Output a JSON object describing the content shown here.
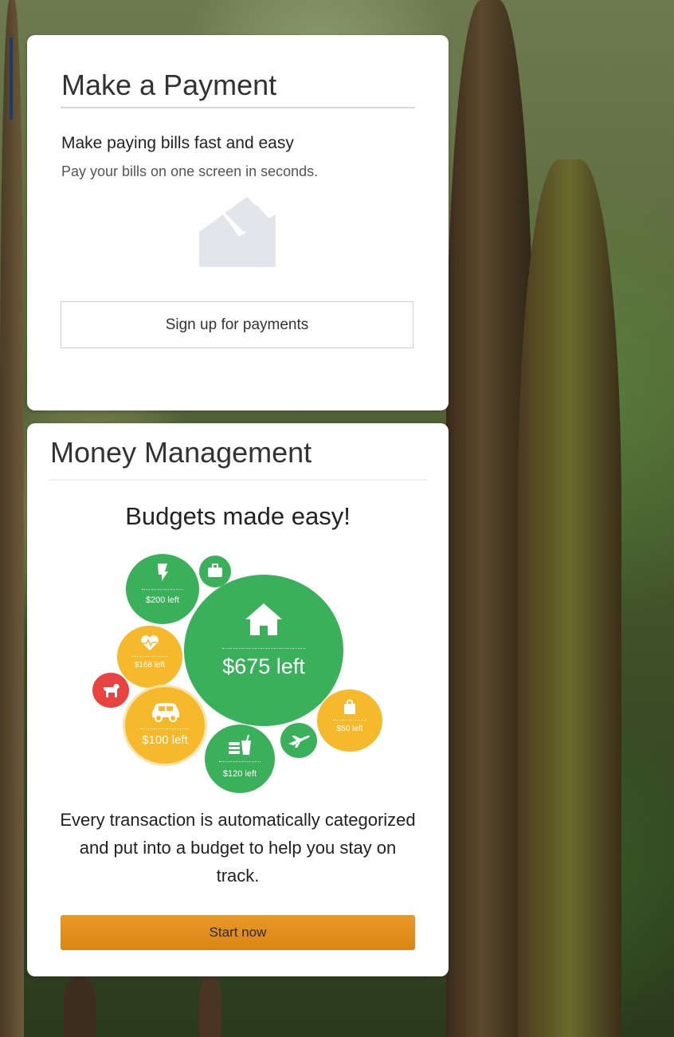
{
  "payment_card": {
    "title": "Make a Payment",
    "subtitle": "Make paying bills fast and easy",
    "description": "Pay your bills on one screen in seconds.",
    "icon": "bill-envelope-icon",
    "button_label": "Sign up for payments"
  },
  "money_card": {
    "title": "Money Management",
    "tagline": "Budgets made easy!",
    "bubbles": [
      {
        "name": "housing",
        "icon": "house-icon",
        "label": "$675 left",
        "color": "#3ab05a"
      },
      {
        "name": "utilities",
        "icon": "lightbulb-icon",
        "label": "$200 left",
        "color": "#3ab05a"
      },
      {
        "name": "health",
        "icon": "heart-pulse-icon",
        "label": "$168 left",
        "color": "#f7b92c"
      },
      {
        "name": "auto",
        "icon": "car-icon",
        "label": "$100 left",
        "color": "#f7b92c"
      },
      {
        "name": "food",
        "icon": "food-drink-icon",
        "label": "$120 left",
        "color": "#3ab05a"
      },
      {
        "name": "shopping",
        "icon": "shopping-bag-icon",
        "label": "$50 left",
        "color": "#f7b92c"
      },
      {
        "name": "work",
        "icon": "briefcase-icon",
        "label": "",
        "color": "#3ab05a"
      },
      {
        "name": "pets",
        "icon": "dog-icon",
        "label": "",
        "color": "#e8433f"
      },
      {
        "name": "travel",
        "icon": "airplane-icon",
        "label": "",
        "color": "#3ab05a"
      }
    ],
    "description": "Every transaction is automatically categorized and put into a budget to help you stay on track.",
    "button_label": "Start now"
  }
}
